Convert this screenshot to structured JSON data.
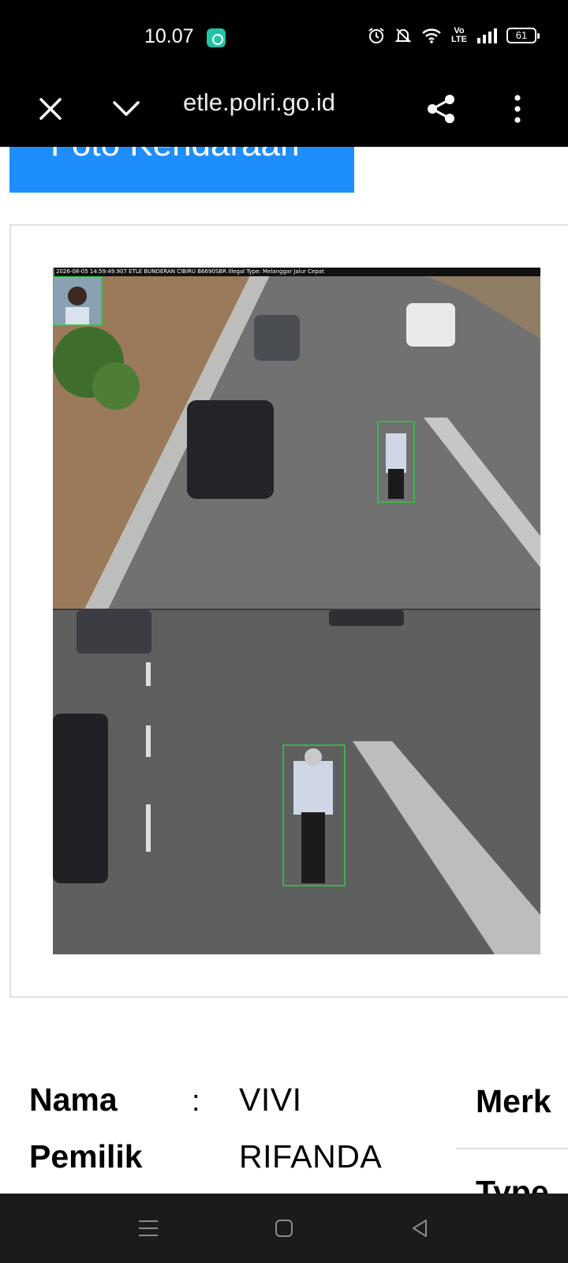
{
  "status_bar": {
    "time": "10.07",
    "volte_top": "Vo",
    "volte_bottom": "LTE",
    "battery": "61"
  },
  "browser": {
    "url": "etle.polri.go.id"
  },
  "section_button": {
    "label": "Foto Kendaraan"
  },
  "photo": {
    "caption": "2026-08-05 14:59:49.907 ETLE BUNDERAN CIBIRU B6690SBR Illegal Type: Melanggar Jalur Cepat"
  },
  "owner": {
    "name_label_line1": "Nama",
    "name_label_line2": "Pemilik",
    "separator": ":",
    "value_line1": "VIVI",
    "value_line2": "RIFANDA"
  },
  "vehicle": {
    "merk_label": "Merk",
    "type_label": "Type"
  }
}
